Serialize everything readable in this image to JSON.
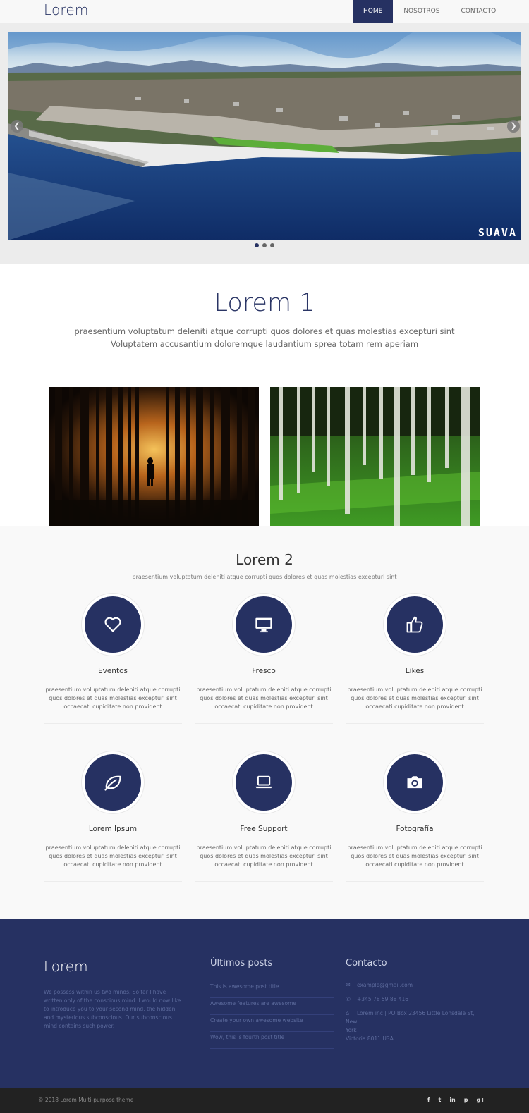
{
  "navbar": {
    "brand": "Lorem",
    "links": [
      {
        "label": "HOME",
        "active": true
      },
      {
        "label": "NOSOTROS",
        "active": false
      },
      {
        "label": "CONTACTO",
        "active": false
      }
    ]
  },
  "hero": {
    "watermark": "SUAVA",
    "slide_count": 3,
    "active_slide": 1,
    "prev_icon": "chevron-left-icon",
    "next_icon": "chevron-right-icon"
  },
  "section1": {
    "title": "Lorem 1",
    "subtitle_line1": "praesentium voluptatum deleniti atque corrupti quos dolores et quas molestias excepturi sint",
    "subtitle_line2": "Voluptatem accusantium doloremque laudantium sprea totam rem aperiam"
  },
  "section2": {
    "title": "Lorem 2",
    "subtitle": "praesentium voluptatum deleniti atque corrupti quos dolores et quas molestias excepturi sint",
    "features": [
      {
        "title": "Eventos",
        "icon": "heart-icon",
        "text": "praesentium voluptatum deleniti atque corrupti quos dolores et quas molestias excepturi sint occaecati cupiditate non provident"
      },
      {
        "title": "Fresco",
        "icon": "monitor-icon",
        "text": "praesentium voluptatum deleniti atque corrupti quos dolores et quas molestias excepturi sint occaecati cupiditate non provident"
      },
      {
        "title": "Likes",
        "icon": "thumbs-up-icon",
        "text": "praesentium voluptatum deleniti atque corrupti quos dolores et quas molestias excepturi sint occaecati cupiditate non provident"
      },
      {
        "title": "Lorem Ipsum",
        "icon": "leaf-icon",
        "text": "praesentium voluptatum deleniti atque corrupti quos dolores et quas molestias excepturi sint occaecati cupiditate non provident"
      },
      {
        "title": "Free Support",
        "icon": "laptop-icon",
        "text": "praesentium voluptatum deleniti atque corrupti quos dolores et quas molestias excepturi sint occaecati cupiditate non provident"
      },
      {
        "title": "Fotografía",
        "icon": "camera-icon",
        "text": "praesentium voluptatum deleniti atque corrupti quos dolores et quas molestias excepturi sint occaecati cupiditate non provident"
      }
    ]
  },
  "footer": {
    "brand": "Lorem",
    "about": "We possess within us two minds. So far I have written only of the conscious mind. I would now like to introduce you to your second mind, the hidden and mysterious subconscious. Our subconscious mind contains such power.",
    "posts_heading": "Últimos posts",
    "posts": [
      "This is awesome post title",
      "Awesome features are awesome",
      "Create your own awesome website",
      "Wow, this is fourth post title"
    ],
    "contact_heading": "Contacto",
    "email": "example@gmail.com",
    "phone": "+345 78 59 88 416",
    "address_line1": "Lorem inc | PO Box 23456 Little Lonsdale St, New",
    "address_line2": "York",
    "address_line3": "Victoria 8011 USA",
    "copyright": "© 2018 Lorem Multi-purpose theme",
    "social": [
      {
        "icon": "facebook-icon",
        "glyph": "f"
      },
      {
        "icon": "twitter-icon",
        "glyph": "t"
      },
      {
        "icon": "linkedin-icon",
        "glyph": "in"
      },
      {
        "icon": "pinterest-icon",
        "glyph": "p"
      },
      {
        "icon": "google-plus-icon",
        "glyph": "g+"
      }
    ]
  },
  "colors": {
    "primary": "#263162",
    "footer_bottom": "#222222",
    "section_bg": "#f9f9f9",
    "hero_bg": "#ececec"
  }
}
